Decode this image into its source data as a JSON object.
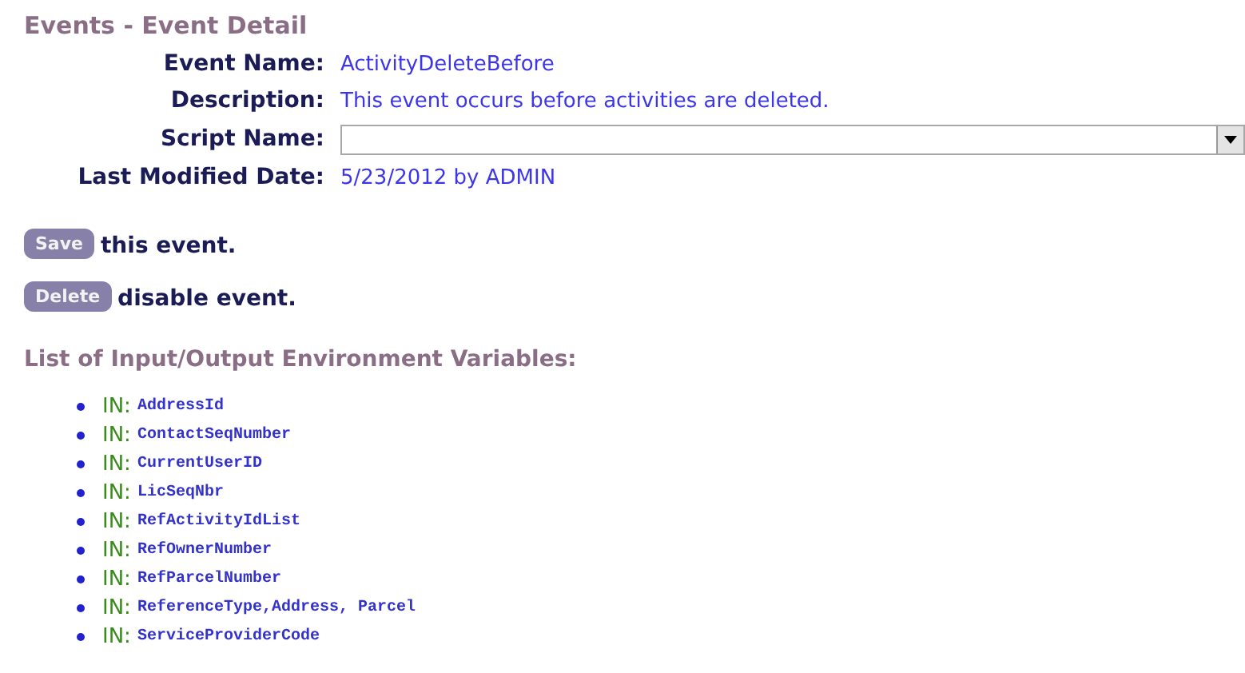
{
  "title": "Events - Event Detail",
  "fields": [
    {
      "kind": "text",
      "label": "Event Name:",
      "value": "ActivityDeleteBefore"
    },
    {
      "kind": "text",
      "label": "Description:",
      "value": "This event occurs before activities are deleted."
    },
    {
      "kind": "select",
      "label": "Script Name:"
    },
    {
      "kind": "text",
      "label": "Last Modified Date:",
      "value": "5/23/2012 by ADMIN"
    }
  ],
  "actions": [
    {
      "button": "Save",
      "text": "this event."
    },
    {
      "button": "Delete",
      "text": "disable event."
    }
  ],
  "variables_heading": "List of Input/Output Environment Variables:",
  "variables": [
    {
      "direction": "IN:",
      "name": "AddressId"
    },
    {
      "direction": "IN:",
      "name": "ContactSeqNumber"
    },
    {
      "direction": "IN:",
      "name": "CurrentUserID"
    },
    {
      "direction": "IN:",
      "name": "LicSeqNbr"
    },
    {
      "direction": "IN:",
      "name": "RefActivityIdList"
    },
    {
      "direction": "IN:",
      "name": "RefOwnerNumber"
    },
    {
      "direction": "IN:",
      "name": "RefParcelNumber"
    },
    {
      "direction": "IN:",
      "name": "ReferenceType,Address, Parcel"
    },
    {
      "direction": "IN:",
      "name": "ServiceProviderCode"
    }
  ]
}
